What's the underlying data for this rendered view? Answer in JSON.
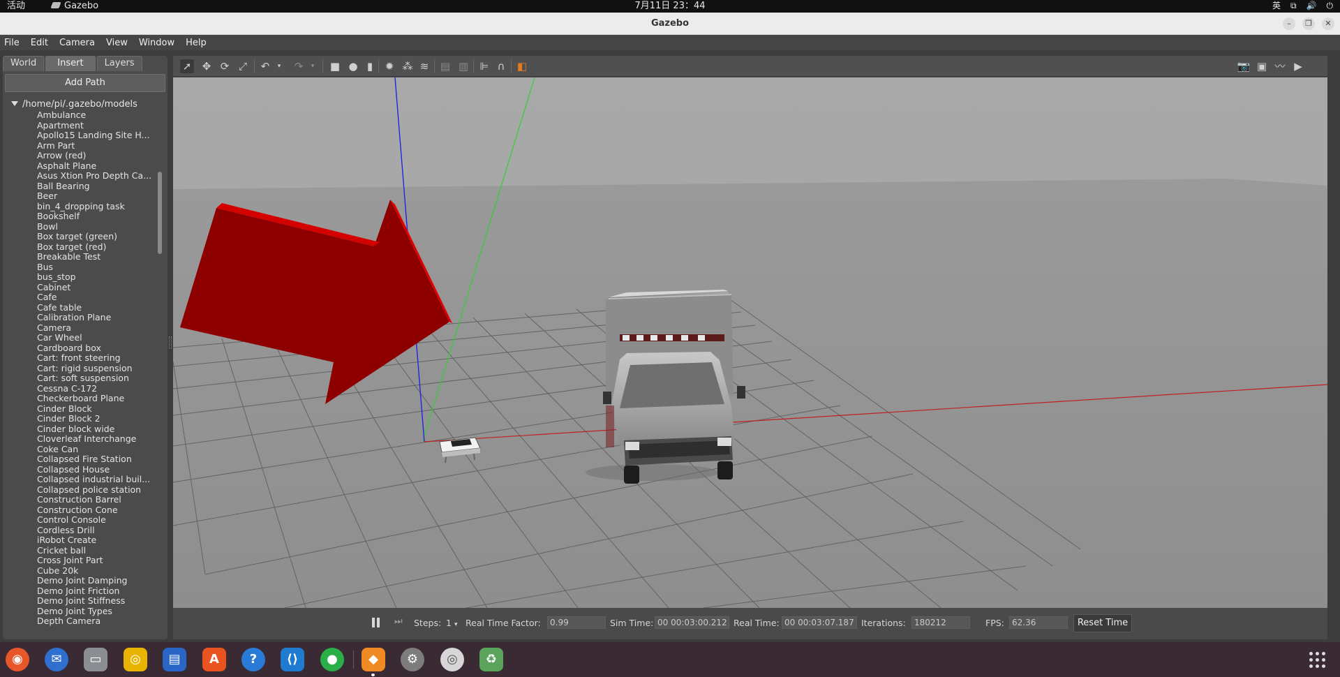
{
  "topbar": {
    "activities": "活动",
    "app_name": "Gazebo",
    "clock": "7月11日  23：44",
    "input_method": "英"
  },
  "window": {
    "title": "Gazebo"
  },
  "menu": [
    "File",
    "Edit",
    "Camera",
    "View",
    "Window",
    "Help"
  ],
  "left_panel": {
    "tabs": [
      "World",
      "Insert",
      "Layers"
    ],
    "active_tab": "Insert",
    "add_path_label": "Add Path",
    "root_path": "/home/pi/.gazebo/models",
    "models": [
      "Ambulance",
      "Apartment",
      "Apollo15 Landing Site H...",
      "Arm Part",
      "Arrow (red)",
      "Asphalt Plane",
      "Asus Xtion Pro Depth Ca...",
      "Ball Bearing",
      "Beer",
      "bin_4_dropping task",
      "Bookshelf",
      "Bowl",
      "Box target (green)",
      "Box target (red)",
      "Breakable Test",
      "Bus",
      "bus_stop",
      "Cabinet",
      "Cafe",
      "Cafe table",
      "Calibration Plane",
      "Camera",
      "Car Wheel",
      "Cardboard box",
      "Cart: front steering",
      "Cart: rigid suspension",
      "Cart: soft suspension",
      "Cessna C-172",
      "Checkerboard Plane",
      "Cinder Block",
      "Cinder Block 2",
      "Cinder block wide",
      "Cloverleaf Interchange",
      "Coke Can",
      "Collapsed Fire Station",
      "Collapsed House",
      "Collapsed industrial buil...",
      "Collapsed police station",
      "Construction Barrel",
      "Construction Cone",
      "Control Console",
      "Cordless Drill",
      "iRobot Create",
      "Cricket ball",
      "Cross Joint Part",
      "Cube 20k",
      "Demo Joint Damping",
      "Demo Joint Friction",
      "Demo Joint Stiffness",
      "Demo Joint Types",
      "Depth Camera"
    ]
  },
  "toolbar_icons": [
    "select-mode-icon",
    "translate-mode-icon",
    "rotate-mode-icon",
    "scale-mode-icon",
    "undo-icon",
    "undo-dropdown-icon",
    "redo-icon",
    "redo-dropdown-icon",
    "box-shape-icon",
    "sphere-shape-icon",
    "cylinder-shape-icon",
    "point-light-icon",
    "spot-light-icon",
    "directional-light-icon",
    "copy-icon",
    "paste-icon",
    "align-icon",
    "snap-icon",
    "view-angle-icon",
    "screenshot-icon",
    "log-icon",
    "plot-icon",
    "record-video-icon"
  ],
  "status": {
    "steps_label": "Steps:",
    "steps_value": "1",
    "rtf_label": "Real Time Factor:",
    "rtf_value": "0.99",
    "sim_time_label": "Sim Time:",
    "sim_time_value": "00 00:03:00.212",
    "real_time_label": "Real Time:",
    "real_time_value": "00 00:03:07.187",
    "iterations_label": "Iterations:",
    "iterations_value": "180212",
    "fps_label": "FPS:",
    "fps_value": "62.36",
    "reset_label": "Reset Time"
  },
  "colors": {
    "arrow_red": "#8e0000",
    "axis_x": "#d02020",
    "axis_y": "#20c020",
    "axis_z": "#2020e0"
  },
  "dock_icons": [
    "firefox-icon",
    "thunderbird-icon",
    "files-icon",
    "rhythmbox-icon",
    "writer-icon",
    "app-center-icon",
    "help-icon",
    "vscode-icon",
    "wechat-icon",
    "gazebo-icon",
    "settings-icon",
    "disc-icon",
    "trash-icon",
    "show-apps-icon"
  ]
}
